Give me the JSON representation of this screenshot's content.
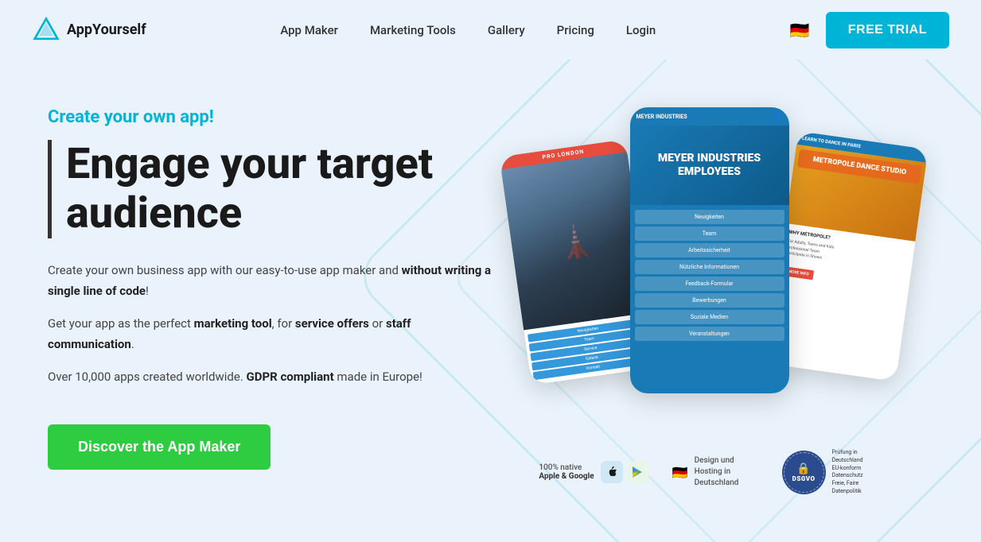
{
  "nav": {
    "logo_text": "AppYourself",
    "links": [
      {
        "label": "App Maker",
        "id": "app-maker"
      },
      {
        "label": "Marketing Tools",
        "id": "marketing-tools"
      },
      {
        "label": "Gallery",
        "id": "gallery"
      },
      {
        "label": "Pricing",
        "id": "pricing"
      },
      {
        "label": "Login",
        "id": "login"
      }
    ],
    "flag": "🇩🇪",
    "cta_label": "FREE TRIAL"
  },
  "hero": {
    "tagline": "Create your own app!",
    "headline_line1": "Engage your target",
    "headline_line2": "audience",
    "body1_plain": "Create your own business app with our easy-to-use app maker and ",
    "body1_bold": "without writing a single line of code",
    "body1_end": "!",
    "body2_plain1": "Get your app as the perfect ",
    "body2_bold1": "marketing tool",
    "body2_plain2": ", for ",
    "body2_bold2": "service offers",
    "body2_plain3": " or ",
    "body2_bold3": "staff communication",
    "body2_end": ".",
    "body3_plain": "Over 10,000 apps created worldwide. ",
    "body3_bold": "GDPR compliant",
    "body3_end": " made in Europe!",
    "cta_label": "Discover the App Maker"
  },
  "phones": {
    "left": {
      "header": "PRO LONDON",
      "location": "LONDON",
      "menu_items": [
        "Neuigkeiten",
        "Team",
        "Service",
        "Galerie",
        "Kontakt"
      ]
    },
    "center": {
      "company": "MEYER INDUSTRIES",
      "subtitle": "EMPLOYEES",
      "menu_items": [
        "Neuigkeiten",
        "Team",
        "Arbeitssicherheit",
        "Nützliche Informationen",
        "Feedback-Formular",
        "Bewerbungen",
        "Soziale Medien",
        "Veranstaltungen"
      ]
    },
    "right": {
      "header": "LEARN TO DANCE IN PARIS",
      "title": "METROPOLE DANCE STUDIO",
      "subtitle": "WHY METROPOLE?",
      "body": "For Adults, Teens and Kids\nProfessional Team\nParticipate in Shows"
    }
  },
  "badges": {
    "native_label": "100% native",
    "native_sub": "Apple & Google",
    "design_label": "Design und Hosting in Deutschland",
    "dsgvo_label": "DSGVO"
  }
}
